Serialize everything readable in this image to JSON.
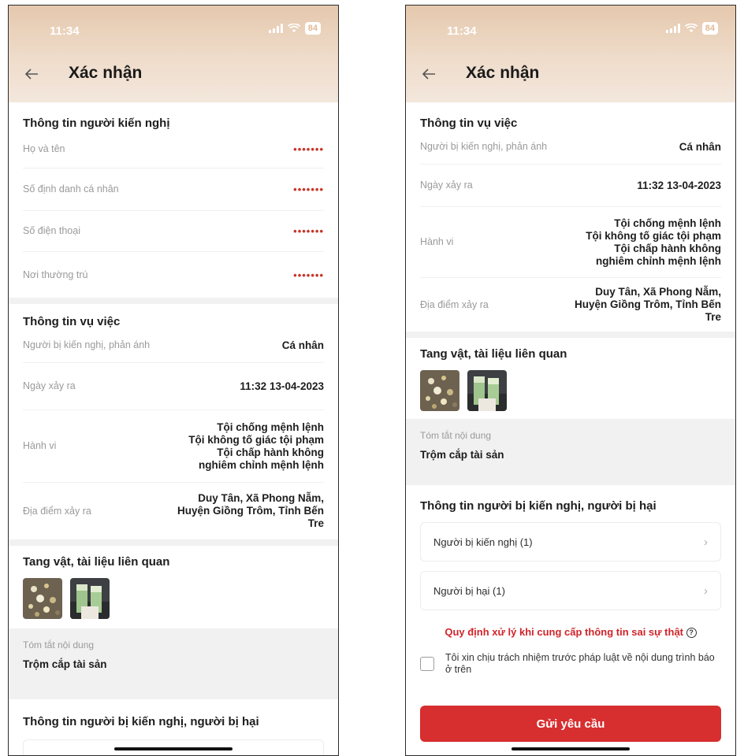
{
  "status": {
    "time": "11:34",
    "battery": "84"
  },
  "nav": {
    "title": "Xác nhận"
  },
  "personal_info": {
    "title": "Thông tin người kiến nghị",
    "rows": [
      {
        "label": "Họ và tên",
        "value": "•••••••"
      },
      {
        "label": "Số định danh cá nhân",
        "value": "•••••••"
      },
      {
        "label": "Số điện thoại",
        "value": "•••••••"
      },
      {
        "label": "Nơi thường trú",
        "value": "•••••••"
      }
    ]
  },
  "case_info": {
    "title": "Thông tin vụ việc",
    "subject": {
      "label": "Người bị kiến nghị, phản ánh",
      "value": "Cá nhân"
    },
    "date": {
      "label": "Ngày xảy ra",
      "value": "11:32 13-04-2023"
    },
    "behavior": {
      "label": "Hành vi",
      "lines": [
        "Tội chống mệnh lệnh",
        "Tội không tố giác tội phạm",
        "Tội chấp hành không",
        "nghiêm chỉnh mệnh lệnh"
      ]
    },
    "location": {
      "label": "Địa điểm xảy ra",
      "lines": [
        "Duy Tân, Xã Phong Nẫm,",
        "Huyện Giồng Trôm, Tỉnh Bến",
        "Tre"
      ]
    }
  },
  "evidence": {
    "title": "Tang vật, tài liệu liên quan"
  },
  "summary": {
    "label": "Tóm tắt nội dung",
    "value": "Trộm cắp tài sản"
  },
  "parties": {
    "title": "Thông tin người bị kiến nghị, người bị hại",
    "items": [
      {
        "label": "Người bị kiến nghị (1)"
      },
      {
        "label": "Người bị hại (1)"
      }
    ]
  },
  "rules_link": "Quy định xử lý khi cung cấp thông tin sai sự thật",
  "agreement": "Tôi xin chịu trách nhiệm trước pháp luật về nội dung trình báo ở trên",
  "submit": "Gửi yêu cầu",
  "colors": {
    "accent": "#d72e2f",
    "header": "#e5c8ad"
  }
}
